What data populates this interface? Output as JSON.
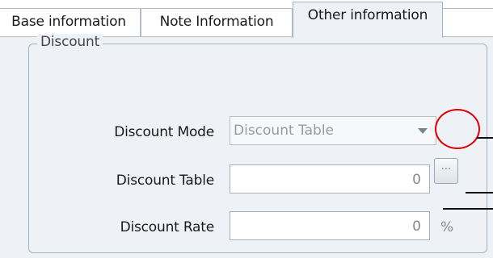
{
  "tabs": [
    {
      "label": "Base information",
      "active": false
    },
    {
      "label": "Note Information",
      "active": false
    },
    {
      "label": "Other information",
      "active": true
    }
  ],
  "discount_group": {
    "legend": "Discount",
    "discount_mode": {
      "label": "Discount Mode",
      "value": "Discount Table"
    },
    "discount_table": {
      "label": "Discount Table",
      "value": "0",
      "browse_button": "..."
    },
    "discount_rate": {
      "label": "Discount Rate",
      "value": "0",
      "unit": "%"
    }
  },
  "annotation": {
    "highlight_color": "#e10000"
  }
}
